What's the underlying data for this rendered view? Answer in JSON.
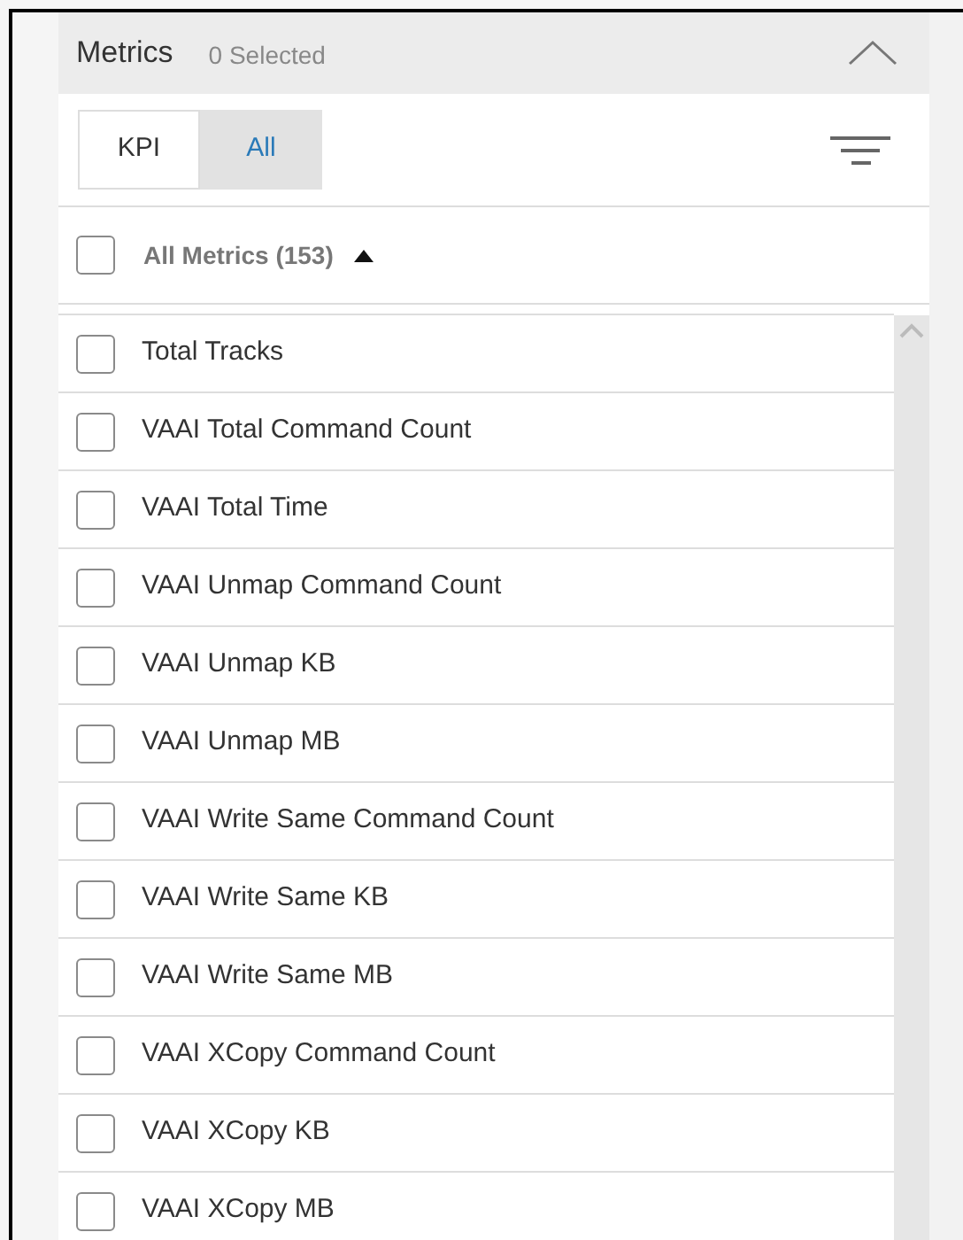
{
  "header": {
    "title": "Metrics",
    "selected_count": "0 Selected",
    "expanded": true
  },
  "tabs": [
    {
      "label": "KPI",
      "selected": false
    },
    {
      "label": "All",
      "selected": true
    }
  ],
  "all_metrics": {
    "label": "All Metrics (153)",
    "checked": false,
    "sort_ascending": true
  },
  "metrics": [
    {
      "label": "Total Tracks",
      "checked": false
    },
    {
      "label": "VAAI Total Command Count",
      "checked": false
    },
    {
      "label": "VAAI Total Time",
      "checked": false
    },
    {
      "label": "VAAI Unmap Command Count",
      "checked": false
    },
    {
      "label": "VAAI Unmap KB",
      "checked": false
    },
    {
      "label": "VAAI Unmap MB",
      "checked": false
    },
    {
      "label": "VAAI Write Same Command Count",
      "checked": false
    },
    {
      "label": "VAAI Write Same KB",
      "checked": false
    },
    {
      "label": "VAAI Write Same MB",
      "checked": false
    },
    {
      "label": "VAAI XCopy Command Count",
      "checked": false
    },
    {
      "label": "VAAI XCopy KB",
      "checked": false
    },
    {
      "label": "VAAI XCopy MB",
      "checked": false
    }
  ]
}
